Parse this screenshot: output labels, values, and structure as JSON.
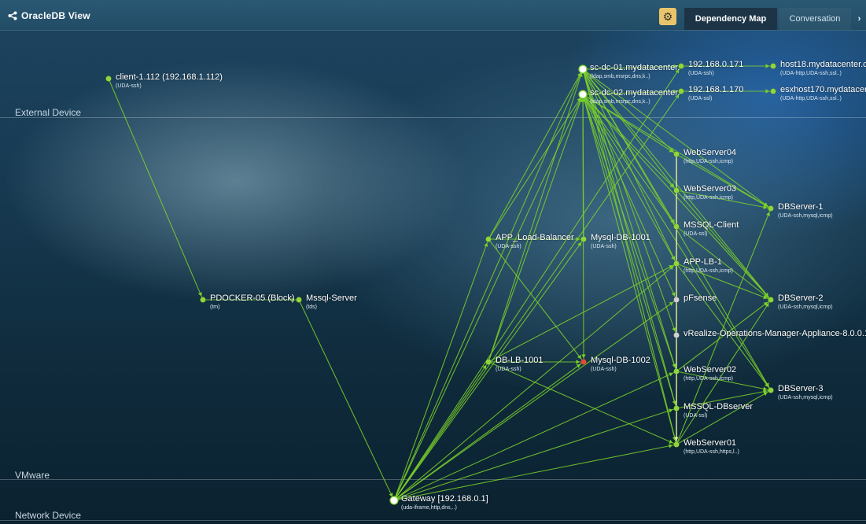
{
  "header": {
    "title": "OracleDB View",
    "tabs": [
      {
        "label": "Dependency Map",
        "active": true
      },
      {
        "label": "Conversation",
        "active": false
      }
    ],
    "more_arrow": "›",
    "settings_icon": "gear-icon"
  },
  "lanes": [
    {
      "label": "External Device"
    },
    {
      "label": "VMware"
    },
    {
      "label": "Network Device"
    }
  ],
  "colors": {
    "edge": "#7bd12a",
    "edge_light": "#e6ed9a",
    "node_default": "#8fd53b",
    "node_cluster": "#ffffff",
    "node_grey": "#d0d0d0",
    "node_alert": "#e24b3b",
    "gear_button": "#e9c46a"
  },
  "nodes": [
    {
      "id": "client",
      "name": "client-1.112 (192.168.1.112)",
      "proto": "(UDA-ssh)"
    },
    {
      "id": "docker",
      "name": "PDOCKER-05 (Block)",
      "proto": "(tm)"
    },
    {
      "id": "mssqlsrv",
      "name": "Mssql-Server",
      "proto": "(tds)"
    },
    {
      "id": "dc01",
      "name": "sc-dc-01.mydatacenter.",
      "proto": "(ldap,smb,msrpc,dns,k..)"
    },
    {
      "id": "dc02",
      "name": "sc-dc-02.mydatacenter.",
      "proto": "(ldap,smb,msrpc,dns,k..)"
    },
    {
      "id": "ip171",
      "name": "192.168.0.171",
      "proto": "(UDA-ssh)"
    },
    {
      "id": "ip170",
      "name": "192.168.1.170",
      "proto": "(UDA-ssl)"
    },
    {
      "id": "host18",
      "name": "host18.mydatacenter.c",
      "proto": "(UDA-http,UDA-ssh,ssl..)"
    },
    {
      "id": "esx170",
      "name": "esxhost170.mydatacen",
      "proto": "(UDA-http,UDA-ssh,ssl..)"
    },
    {
      "id": "ws04",
      "name": "WebServer04",
      "proto": "(http,UDA-ssh,icmp)"
    },
    {
      "id": "ws03",
      "name": "WebServer03",
      "proto": "(http,UDA-ssh,icmp)"
    },
    {
      "id": "mssqlclient",
      "name": "MSSQL-Client",
      "proto": "(UDA-ssl)"
    },
    {
      "id": "applb1",
      "name": "APP-LB-1",
      "proto": "(http,UDA-ssh,icmp)"
    },
    {
      "id": "pfsense",
      "name": "pFsense",
      "proto": ""
    },
    {
      "id": "vrops",
      "name": "vRealize-Operations-Manager-Appliance-8.0.0.1",
      "proto": ""
    },
    {
      "id": "ws02",
      "name": "WebServer02",
      "proto": "(http,UDA-ssh,icmp)"
    },
    {
      "id": "mssqldb",
      "name": "MSSQL-DBserver",
      "proto": "(UDA-ssl)"
    },
    {
      "id": "ws01",
      "name": "WebServer01",
      "proto": "(http,UDA-ssh,https,l..)"
    },
    {
      "id": "db1",
      "name": "DBServer-1",
      "proto": "(UDA-ssh,mysql,icmp)"
    },
    {
      "id": "db2",
      "name": "DBServer-2",
      "proto": "(UDA-ssh,mysql,icmp)"
    },
    {
      "id": "db3",
      "name": "DBServer-3",
      "proto": "(UDA-ssh,mysql,icmp)"
    },
    {
      "id": "applbal",
      "name": "APP_Load-Balancer",
      "proto": "(UDA-ssh)"
    },
    {
      "id": "mysql1001",
      "name": "Mysql-DB-1001",
      "proto": "(UDA-ssh)"
    },
    {
      "id": "dblb",
      "name": "DB-LB-1001",
      "proto": "(UDA-ssh)"
    },
    {
      "id": "mysql1002",
      "name": "Mysql-DB-1002",
      "proto": "(UDA-ssh)"
    },
    {
      "id": "gateway",
      "name": "Gateway [192.168.0.1]",
      "proto": "(uda-iframe,http,dns,..)"
    }
  ]
}
